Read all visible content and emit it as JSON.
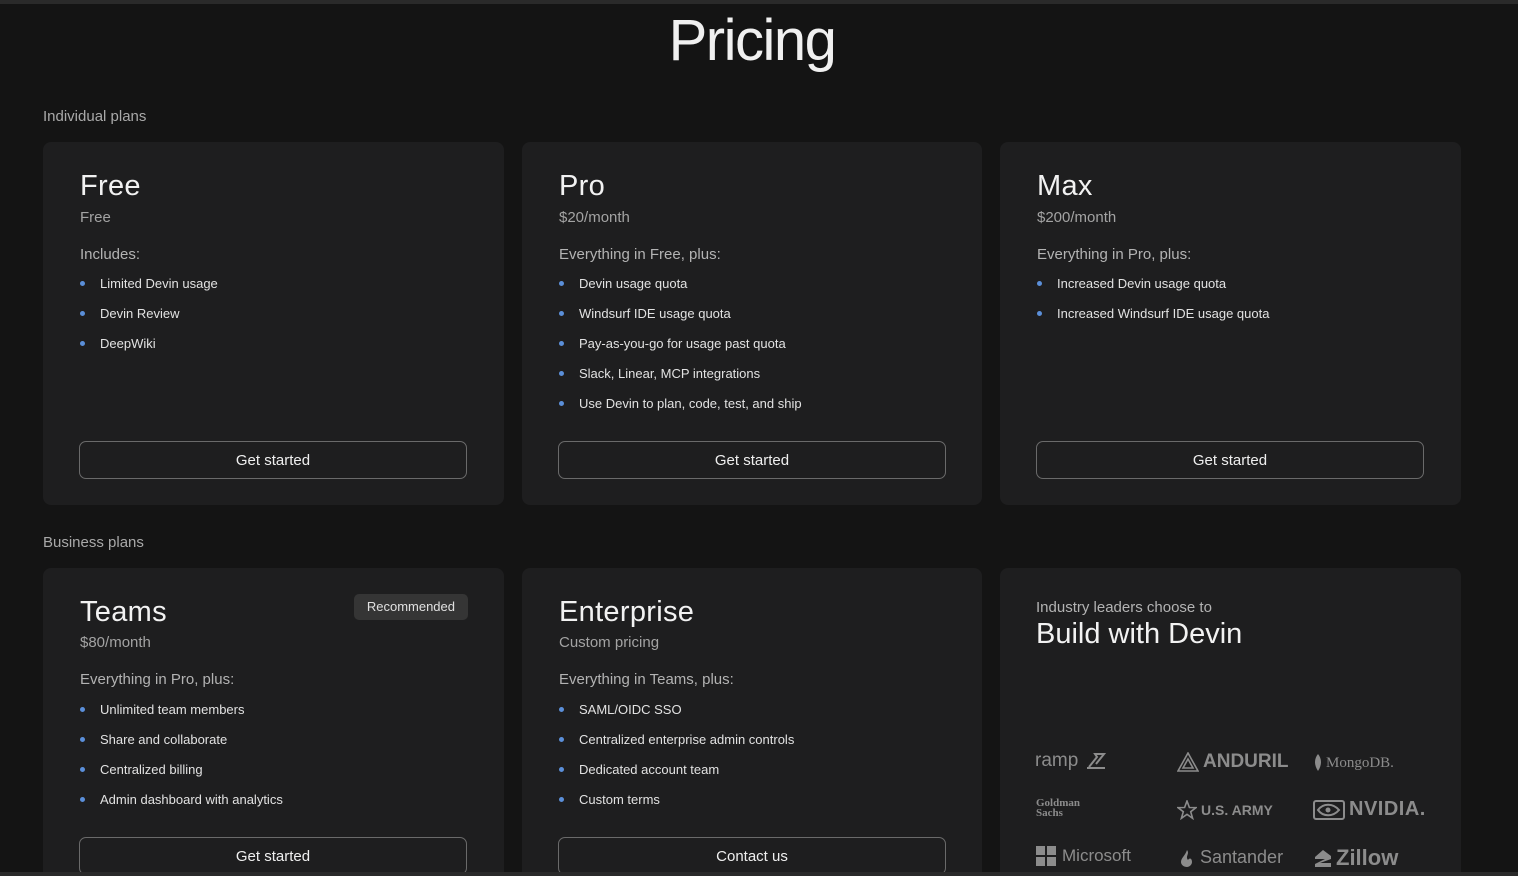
{
  "page": {
    "title": "Pricing"
  },
  "sections": {
    "individual": "Individual plans",
    "business": "Business plans"
  },
  "accent": "#5b8fd9",
  "plans": {
    "free": {
      "name": "Free",
      "price": "Free",
      "includes": "Includes:",
      "features": [
        "Limited Devin usage",
        "Devin Review",
        "DeepWiki"
      ],
      "cta": "Get started"
    },
    "pro": {
      "name": "Pro",
      "price": "$20/month",
      "includes": "Everything in Free, plus:",
      "features": [
        "Devin usage quota",
        "Windsurf IDE usage quota",
        "Pay-as-you-go for usage past quota",
        "Slack, Linear, MCP integrations",
        "Use Devin to plan, code, test, and ship"
      ],
      "cta": "Get started"
    },
    "max": {
      "name": "Max",
      "price": "$200/month",
      "includes": "Everything in Pro, plus:",
      "features": [
        "Increased Devin usage quota",
        "Increased Windsurf IDE usage quota"
      ],
      "cta": "Get started"
    },
    "teams": {
      "name": "Teams",
      "badge": "Recommended",
      "price": "$80/month",
      "includes": "Everything in Pro, plus:",
      "features": [
        "Unlimited team members",
        "Share and collaborate",
        "Centralized billing",
        "Admin dashboard with analytics"
      ],
      "cta": "Get started"
    },
    "enterprise": {
      "name": "Enterprise",
      "price": "Custom pricing",
      "includes": "Everything in Teams, plus:",
      "features": [
        "SAML/OIDC SSO",
        "Centralized enterprise admin controls",
        "Dedicated account team",
        "Custom terms"
      ],
      "cta": "Contact us"
    }
  },
  "leaders": {
    "eyebrow": "Industry leaders choose to",
    "title": "Build with Devin",
    "logos": {
      "ramp": "ramp",
      "anduril": "ANDURIL",
      "mongodb": "MongoDB.",
      "goldman_line1": "Goldman",
      "goldman_line2": "Sachs",
      "usarmy": "U.S. ARMY",
      "nvidia": "NVIDIA.",
      "microsoft": "Microsoft",
      "santander": "Santander",
      "zillow": "Zillow"
    }
  }
}
